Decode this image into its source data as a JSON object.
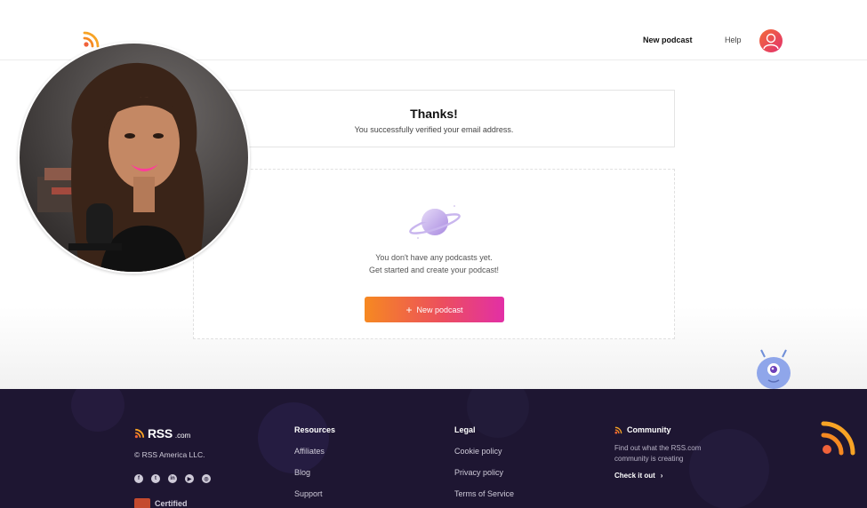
{
  "header": {
    "new_podcast_label": "New podcast",
    "help_label": "Help"
  },
  "thanks_card": {
    "title": "Thanks!",
    "subtitle": "You successfully verified your email address."
  },
  "empty_state": {
    "line1": "You don't have any podcasts yet.",
    "line2": "Get started and create your podcast!",
    "button_label": "New podcast",
    "button_icon": "plus-icon"
  },
  "footer": {
    "brand": "RSS",
    "brand_domain": ".com",
    "copyright": "© RSS America LLC.",
    "social_icons": [
      "facebook-icon",
      "twitter-icon",
      "linkedin-icon",
      "youtube-icon",
      "instagram-icon"
    ],
    "certified_label": "Certified",
    "resources": {
      "heading": "Resources",
      "links": [
        "Affiliates",
        "Blog",
        "Support"
      ]
    },
    "legal": {
      "heading": "Legal",
      "links": [
        "Cookie policy",
        "Privacy policy",
        "Terms of Service"
      ]
    },
    "community": {
      "heading": "Community",
      "description": "Find out what the RSS.com community is creating",
      "cta": "Check it out"
    }
  },
  "colors": {
    "brand_orange": "#f68921",
    "brand_pink": "#e22fa6",
    "footer_bg": "#1e1632",
    "planet_purple": "#b79ce8"
  }
}
